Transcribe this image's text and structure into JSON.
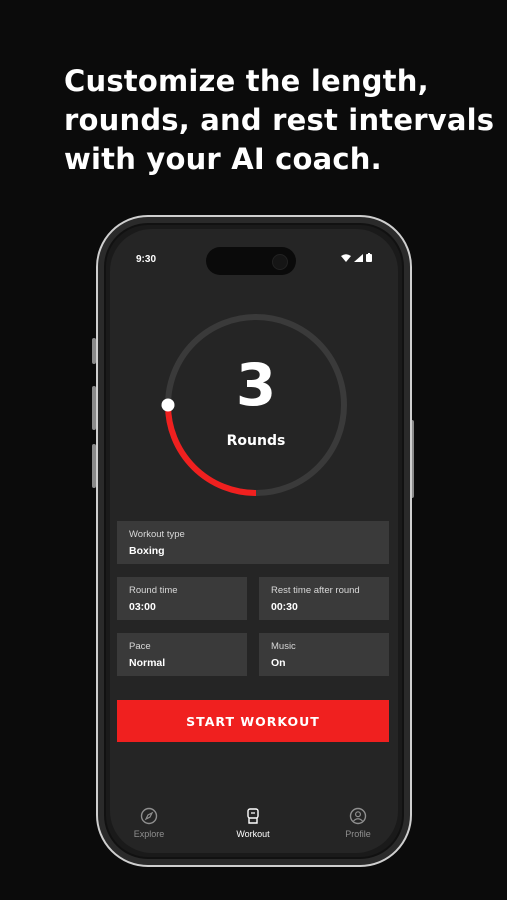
{
  "headline": {
    "line1": "Customize the length,",
    "line2": "rounds, and rest intervals",
    "line3": "with your AI coach."
  },
  "status_bar": {
    "time": "9:30"
  },
  "rounds": {
    "value": "3",
    "label": "Rounds",
    "progress": 0.25
  },
  "fields": {
    "workout_type": {
      "label": "Workout type",
      "value": "Boxing"
    },
    "round_time": {
      "label": "Round time",
      "value": "03:00"
    },
    "rest_time": {
      "label": "Rest time after round",
      "value": "00:30"
    },
    "pace": {
      "label": "Pace",
      "value": "Normal"
    },
    "music": {
      "label": "Music",
      "value": "On"
    }
  },
  "start_button": {
    "label": "START WORKOUT"
  },
  "nav": {
    "items": [
      {
        "label": "Explore",
        "icon": "compass-icon"
      },
      {
        "label": "Workout",
        "icon": "workout-icon"
      },
      {
        "label": "Profile",
        "icon": "profile-icon"
      }
    ],
    "active": "Workout"
  },
  "colors": {
    "accent": "#f0201f",
    "background": "#0b0b0b",
    "screen": "#252525",
    "card": "#3a3a3a"
  }
}
